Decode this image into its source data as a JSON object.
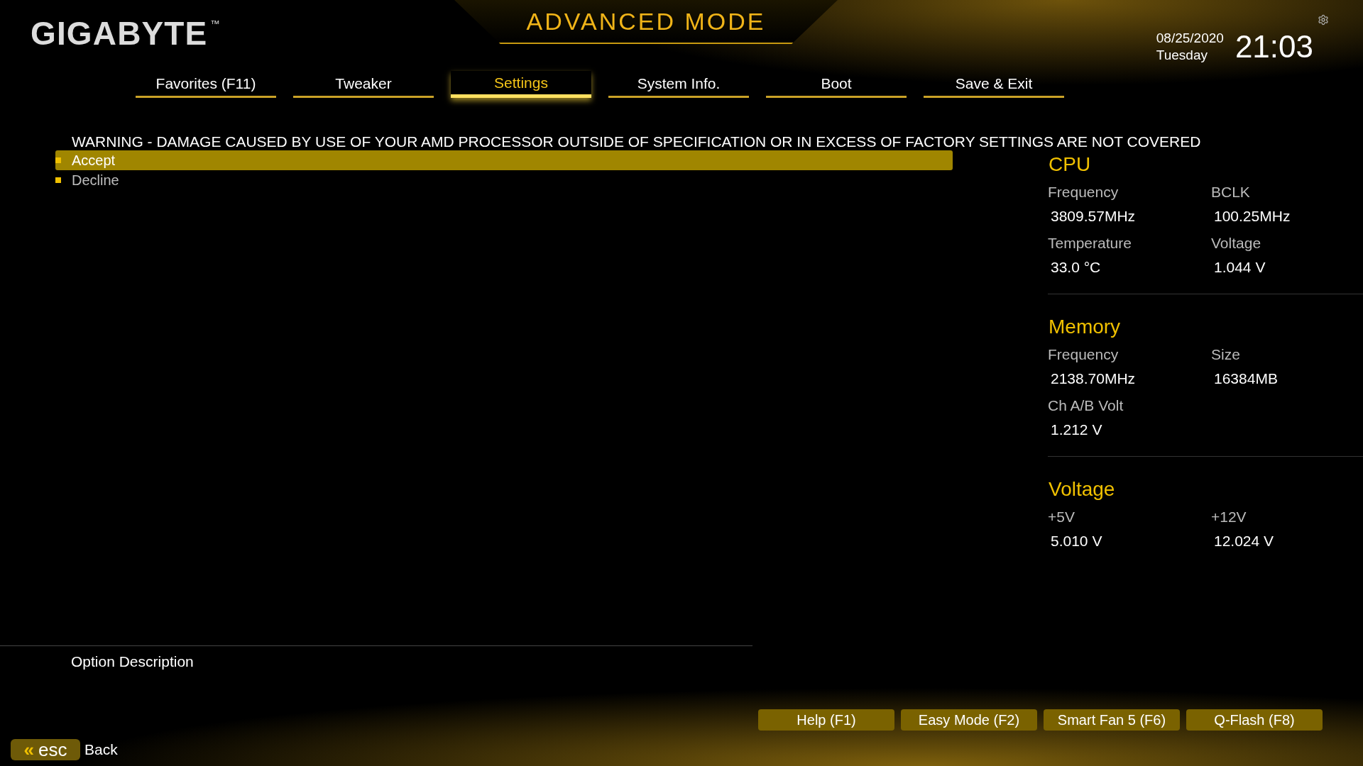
{
  "header": {
    "logo": "GIGABYTE",
    "logo_mark": "™",
    "title": "ADVANCED MODE",
    "date": "08/25/2020",
    "day": "Tuesday",
    "time": "21:03"
  },
  "tabs": [
    {
      "label": "Favorites (F11)",
      "selected": false
    },
    {
      "label": "Tweaker",
      "selected": false
    },
    {
      "label": "Settings",
      "selected": true
    },
    {
      "label": "System Info.",
      "selected": false
    },
    {
      "label": "Boot",
      "selected": false
    },
    {
      "label": "Save & Exit",
      "selected": false
    }
  ],
  "warning": "WARNING - DAMAGE CAUSED BY USE OF YOUR AMD PROCESSOR OUTSIDE OF SPECIFICATION OR IN EXCESS OF FACTORY SETTINGS ARE NOT COVERED",
  "options": [
    {
      "label": "Accept",
      "selected": true
    },
    {
      "label": "Decline",
      "selected": false
    }
  ],
  "info_panel": [
    {
      "title": "CPU",
      "fields": [
        {
          "label": "Frequency",
          "value": "3809.57MHz"
        },
        {
          "label": "BCLK",
          "value": "100.25MHz"
        },
        {
          "label": "Temperature",
          "value": "33.0 °C"
        },
        {
          "label": "Voltage",
          "value": "1.044 V"
        }
      ]
    },
    {
      "title": "Memory",
      "fields": [
        {
          "label": "Frequency",
          "value": "2138.70MHz"
        },
        {
          "label": "Size",
          "value": "16384MB"
        },
        {
          "label": "Ch A/B Volt",
          "value": "1.212 V"
        }
      ]
    },
    {
      "title": "Voltage",
      "fields": [
        {
          "label": "+5V",
          "value": "5.010 V"
        },
        {
          "label": "+12V",
          "value": "12.024 V"
        }
      ]
    }
  ],
  "option_description": {
    "title": "Option Description"
  },
  "function_buttons": [
    "Help (F1)",
    "Easy Mode (F2)",
    "Smart Fan 5 (F6)",
    "Q-Flash (F8)"
  ],
  "esc": {
    "chevron": "«",
    "key": "esc",
    "label": "Back"
  }
}
